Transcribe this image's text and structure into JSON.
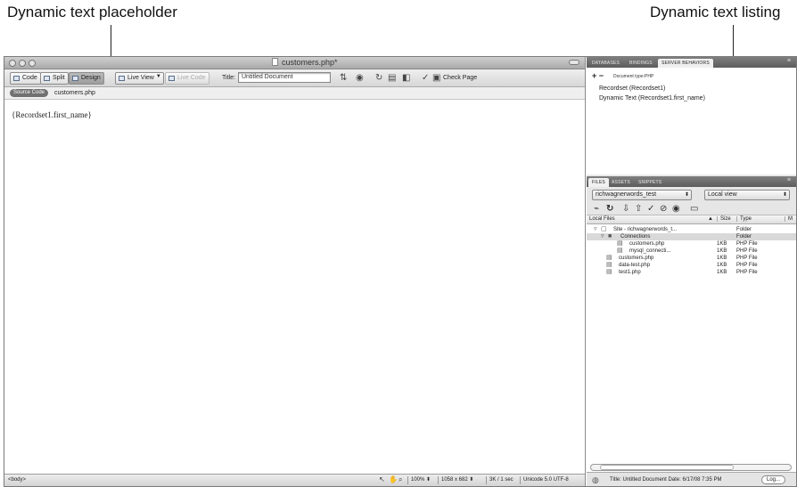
{
  "callouts": {
    "left": "Dynamic text placeholder",
    "right": "Dynamic text listing"
  },
  "window": {
    "title": "customers.php*"
  },
  "toolbar": {
    "code": "Code",
    "split": "Split",
    "design": "Design",
    "live_view": "Live View",
    "live_code": "Live Code",
    "title_label": "Title:",
    "title_value": "Untitled Document",
    "check_page": "Check Page"
  },
  "related": {
    "source_code": "Source Code",
    "file": "customers.php"
  },
  "canvas": {
    "dynamic_text": "{Recordset1.first_name}"
  },
  "status": {
    "tag": "<body>",
    "zoom": "100%",
    "dimensions": "1058 x 682",
    "download": "3K / 1 sec",
    "encoding": "Unicode 5.0 UTF-8"
  },
  "server_panel": {
    "tabs": [
      "DATABASES",
      "BINDINGS",
      "SERVER BEHAVIORS"
    ],
    "doc_type": "Document type:PHP",
    "items": [
      "Recordset (Recordset1)",
      "Dynamic Text (Recordset1.first_name)"
    ]
  },
  "files_panel": {
    "tabs": [
      "FILES",
      "ASSETS",
      "SNIPPETS"
    ],
    "site": "richwagnerwords_test",
    "view": "Local view",
    "headers": {
      "name": "Local Files",
      "size": "Size",
      "type": "Type",
      "more": "M"
    },
    "rows": [
      {
        "name": "Site - richwagnerwords_t...",
        "size": "",
        "type": "Folder"
      },
      {
        "name": "Connections",
        "size": "",
        "type": "Folder"
      },
      {
        "name": "customers.php",
        "size": "1KB",
        "type": "PHP File"
      },
      {
        "name": "mysql_connecti...",
        "size": "1KB",
        "type": "PHP File"
      },
      {
        "name": "customers.php",
        "size": "1KB",
        "type": "PHP File"
      },
      {
        "name": "data-test.php",
        "size": "1KB",
        "type": "PHP File"
      },
      {
        "name": "test1.php",
        "size": "1KB",
        "type": "PHP File"
      }
    ],
    "status_text": "Title: Untitled Document  Date: 6/17/08 7:35 PM",
    "log": "Log..."
  }
}
